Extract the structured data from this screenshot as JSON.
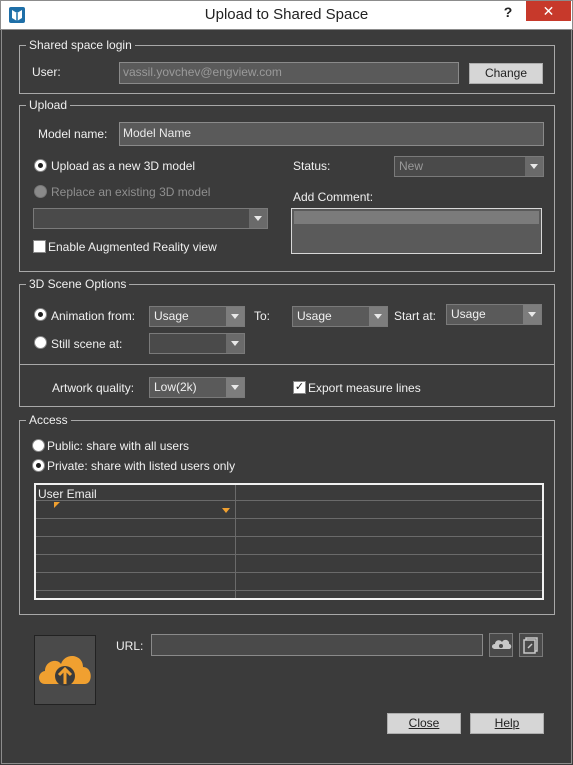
{
  "window": {
    "title": "Upload to Shared Space",
    "help_symbol": "?",
    "close_symbol": "✕"
  },
  "login": {
    "legend": "Shared space login",
    "user_label": "User:",
    "user_value": "vassil.yovchev@engview.com",
    "change_label": "Change"
  },
  "upload": {
    "legend": "Upload",
    "model_name_label": "Model name:",
    "model_name_value": "Model Name",
    "new_model_label": "Upload as a new 3D model",
    "replace_label": "Replace an existing 3D model",
    "status_label": "Status:",
    "status_value": "New",
    "add_comment_label": "Add Comment:",
    "ar_label": "Enable Augmented Reality view"
  },
  "scene": {
    "legend": "3D Scene Options",
    "animation_label": "Animation from:",
    "animation_from": "Usage",
    "to_label": "To:",
    "animation_to": "Usage",
    "start_label": "Start at:",
    "start_value": "Usage",
    "still_label": "Still scene at:",
    "still_value": "",
    "quality_label": "Artwork quality:",
    "quality_value": "Low(2k)",
    "export_label": "Export measure lines"
  },
  "access": {
    "legend": "Access",
    "public_label": "Public: share with all users",
    "private_label": "Private: share with listed users only",
    "column_header": "User Email"
  },
  "footer": {
    "url_label": "URL:",
    "url_value": "",
    "close_label": "Close",
    "help_label": "Help"
  },
  "colors": {
    "background": "#3b3b3b",
    "accent": "#f0a030",
    "close_red": "#c7392b"
  }
}
